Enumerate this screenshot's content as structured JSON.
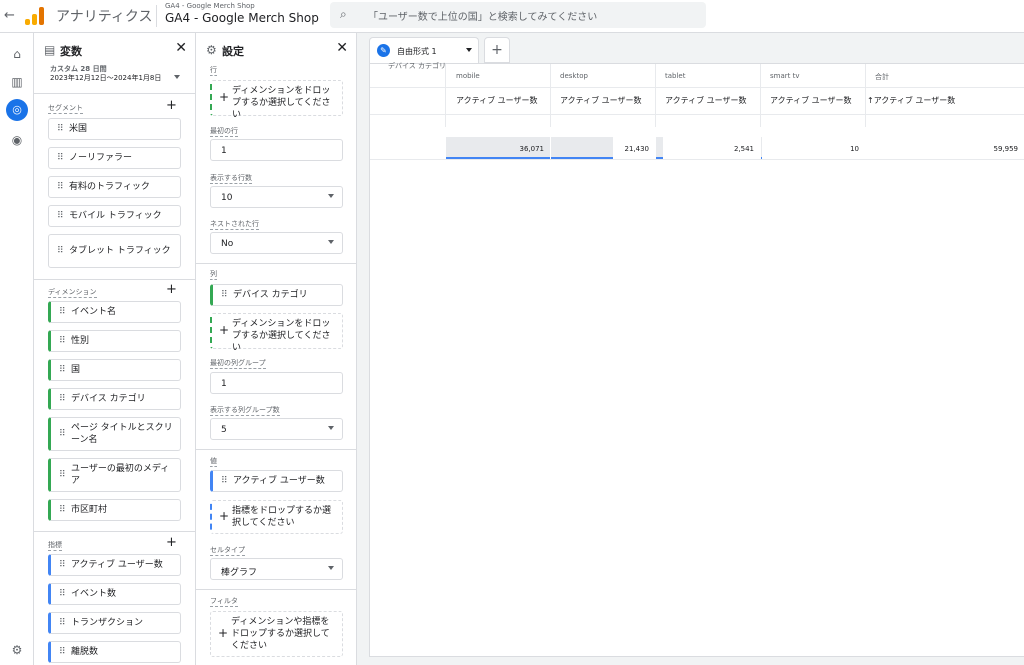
{
  "top": {
    "back_icon": "arrow-left-icon",
    "app_title": "アナリティクス",
    "account_small": "GA4 - Google Merch Shop",
    "account_name": "GA4 - Google Merch Shop",
    "search_placeholder": "「ユーザー数で上位の国」と検索してみてください"
  },
  "rail": {
    "icons": [
      "home-icon",
      "reports-icon",
      "explore-icon",
      "advertising-icon",
      "settings-icon"
    ]
  },
  "variables": {
    "title": "変数",
    "date_label": "カスタム 28 日間",
    "date_range": "2023年12月12日～2024年1月8日",
    "segments_label": "セグメント",
    "segments": [
      "米国",
      "ノーリファラー",
      "有料のトラフィック",
      "モバイル トラフィック",
      "タブレット トラフィック"
    ],
    "dimensions_label": "ディメンション",
    "dimensions": [
      "イベント名",
      "性別",
      "国",
      "デバイス カテゴリ",
      "ページ タイトルとスクリーン名",
      "ユーザーの最初のメディア",
      "市区町村"
    ],
    "metrics_label": "指標",
    "metrics": [
      "アクティブ ユーザー数",
      "イベント数",
      "トランザクション",
      "離脱数"
    ]
  },
  "settings": {
    "title": "設定",
    "rows_label": "行",
    "rows_drop": "ディメンションをドロップするか選択してください",
    "first_row_label": "最初の行",
    "first_row": "1",
    "show_rows_label": "表示する行数",
    "show_rows": "10",
    "nested_label": "ネストされた行",
    "nested": "No",
    "columns_label": "列",
    "column_dimension": "デバイス カテゴリ",
    "columns_drop": "ディメンションをドロップするか選択してください",
    "first_col_group_label": "最初の列グループ",
    "first_col_group": "1",
    "show_col_groups_label": "表示する列グループ数",
    "show_col_groups": "5",
    "values_label": "値",
    "value_metric": "アクティブ ユーザー数",
    "values_drop": "指標をドロップするか選択してください",
    "cell_type_label": "セルタイプ",
    "cell_type": "棒グラフ",
    "filters_label": "フィルタ",
    "filters_drop": "ディメンションや指標をドロップするか選択してください"
  },
  "canvas": {
    "tab_label": "自由形式 1",
    "corner_header": "デバイス カテゴリ",
    "columns": [
      "mobile",
      "desktop",
      "tablet",
      "smart tv",
      "合計"
    ],
    "metric_header": "アクティブ ユーザー数",
    "total_metric_header": "↑アクティブ ユーザー数",
    "values": [
      "36,071",
      "21,430",
      "2,541",
      "10",
      "59,959"
    ],
    "bar_fractions": [
      1.0,
      0.594,
      0.07,
      0.0003
    ]
  }
}
